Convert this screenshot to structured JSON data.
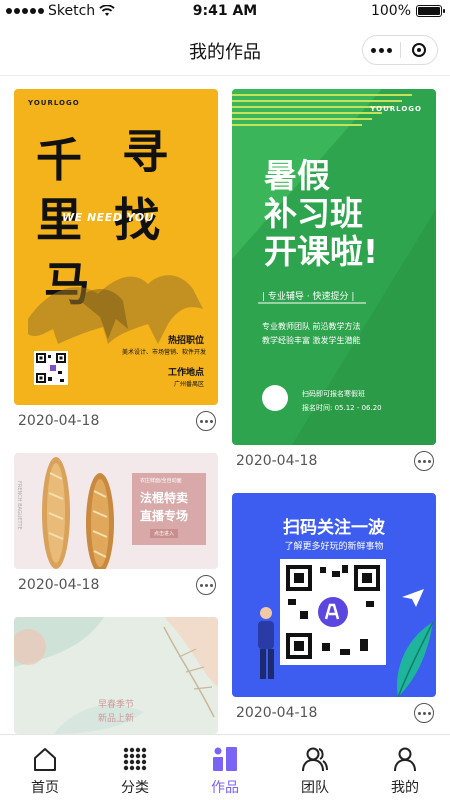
{
  "status_bar": {
    "carrier": "Sketch",
    "time": "9:41 AM",
    "battery": "100%"
  },
  "navbar": {
    "title": "我的作品"
  },
  "works": [
    {
      "date": "2020-04-18",
      "logo": "YOURLOGO",
      "chars": [
        "千",
        "寻",
        "里",
        "找",
        "马"
      ],
      "english": "WE NEED YOU",
      "line1": "热招职位",
      "line2": "美术设计、市场营销、软件开发",
      "line3": "工作地点",
      "line4": "广州番禺区"
    },
    {
      "date": "2020-04-18",
      "logo": "YOURLOGO",
      "title_lines": [
        "暑假",
        "补习班",
        "开课啦!"
      ],
      "pill": "| 专业辅导 · 快速提分 |",
      "desc1": "专业教师团队 前沿教学方法",
      "desc2": "教学经验丰富 激发学生潜能",
      "scan": "扫码即可报名寒假班",
      "period": "报名时间: 05.12 - 06.20"
    },
    {
      "date": "2020-04-18",
      "side": "FRENCH BAGUETTE",
      "tag_small": "农庄鲜面/全自动面",
      "tag_line1": "法棍特卖",
      "tag_line2": "直播专场",
      "tag_btn": "点击进入"
    },
    {
      "date": "2020-04-18",
      "headline": "扫码关注一波",
      "sub": "了解更多好玩的新鲜事物"
    },
    {
      "line1": "早春季节",
      "line2": "新品上新"
    }
  ],
  "tabs": [
    {
      "label": "首页",
      "icon": "home-icon"
    },
    {
      "label": "分类",
      "icon": "grid-icon"
    },
    {
      "label": "作品",
      "icon": "works-icon",
      "active": true
    },
    {
      "label": "团队",
      "icon": "team-icon"
    },
    {
      "label": "我的",
      "icon": "profile-icon"
    }
  ],
  "colors": {
    "accent": "#7b63f5",
    "yellow_card": "#f4b21b",
    "green_card": "#2fa44e",
    "blue_card": "#3d5cf0"
  }
}
